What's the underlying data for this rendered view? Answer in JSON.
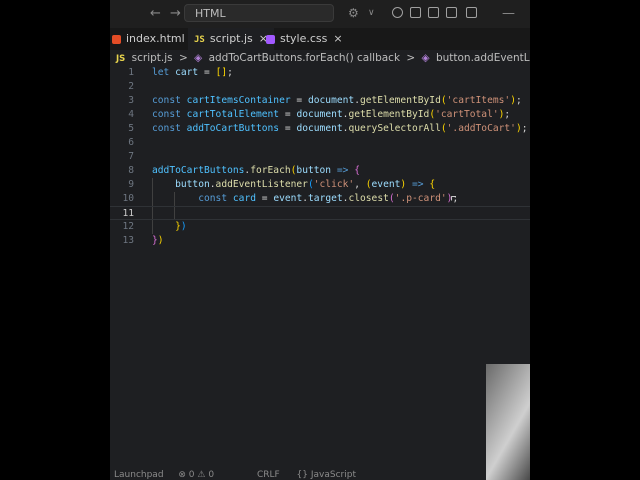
{
  "titlebar": {
    "back_icon": "arrow-left-icon",
    "forward_icon": "arrow-right-icon",
    "command_center": "HTML"
  },
  "tabs": [
    {
      "label": "index.html",
      "icon": "html-file-icon",
      "color": "#e44d26",
      "close": "×"
    },
    {
      "label": "script.js",
      "icon": "js-file-icon",
      "icon_text": "JS",
      "close": "×",
      "active": true
    },
    {
      "label": "style.css",
      "icon": "css-file-icon",
      "color": "#a259ff",
      "close": "×"
    }
  ],
  "breadcrumb": {
    "file_icon": "JS",
    "file": "script.js",
    "sep": ">",
    "part1": "addToCartButtons.forEach() callback",
    "part2": "button.addEventListener('click') callback"
  },
  "code_lines": [
    {
      "n": "1",
      "text": "let cart = [];"
    },
    {
      "n": "2",
      "text": ""
    },
    {
      "n": "3",
      "text": "const cartItemsContainer = document.getElementById('cartItems');"
    },
    {
      "n": "4",
      "text": "const cartTotalElement = document.getElementById('cartTotal');"
    },
    {
      "n": "5",
      "text": "const addToCartButtons = document.querySelectorAll('.addToCart');"
    },
    {
      "n": "6",
      "text": ""
    },
    {
      "n": "7",
      "text": ""
    },
    {
      "n": "8",
      "text": "addToCartButtons.forEach(button => {"
    },
    {
      "n": "9",
      "text": "    button.addEventListener('click', (event) => {"
    },
    {
      "n": "10",
      "text": "        const card = event.target.closest('.p-card');"
    },
    {
      "n": "11",
      "text": ""
    },
    {
      "n": "12",
      "text": "    })"
    },
    {
      "n": "13",
      "text": "})"
    }
  ],
  "status": {
    "launchpad": "Launchpad",
    "errors": "⊗ 0 ⚠ 0",
    "eol": "CRLF",
    "lang": "{} JavaScript"
  }
}
